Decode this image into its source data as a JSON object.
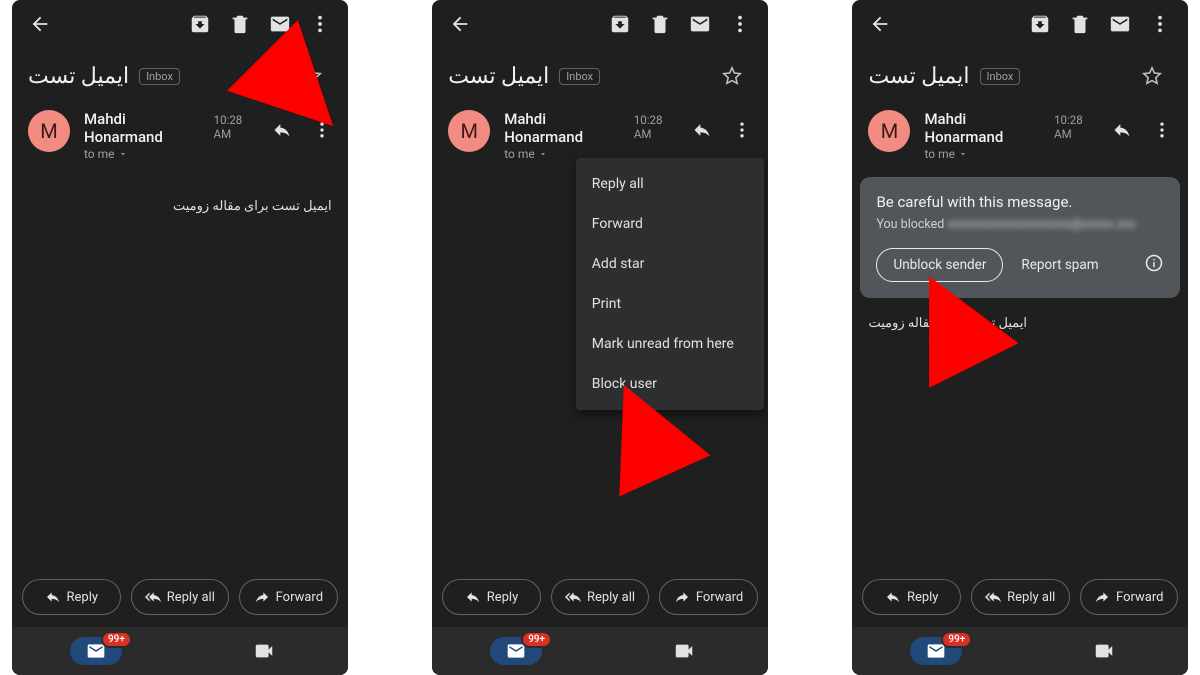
{
  "common": {
    "subject": "ایمیل تست",
    "inbox_label": "Inbox",
    "sender_name": "Mahdi Honarmand",
    "sender_time": "10:28 AM",
    "recipient_prefix": "to me",
    "avatar_letter": "M",
    "body_text": "ایمیل تست برای مقاله زومیت",
    "reply_label": "Reply",
    "reply_all_label": "Reply all",
    "forward_label": "Forward",
    "badge_count": "99+"
  },
  "menu": {
    "items": [
      "Reply all",
      "Forward",
      "Add star",
      "Print",
      "Mark unread from here",
      "Block user"
    ]
  },
  "warning": {
    "title": "Be careful with this message.",
    "you_blocked": "You blocked",
    "blocked_address": "xxxxxxxxxxxxxxxxxxxx@xxxxx.xxx",
    "unblock_label": "Unblock sender",
    "report_label": "Report spam"
  }
}
